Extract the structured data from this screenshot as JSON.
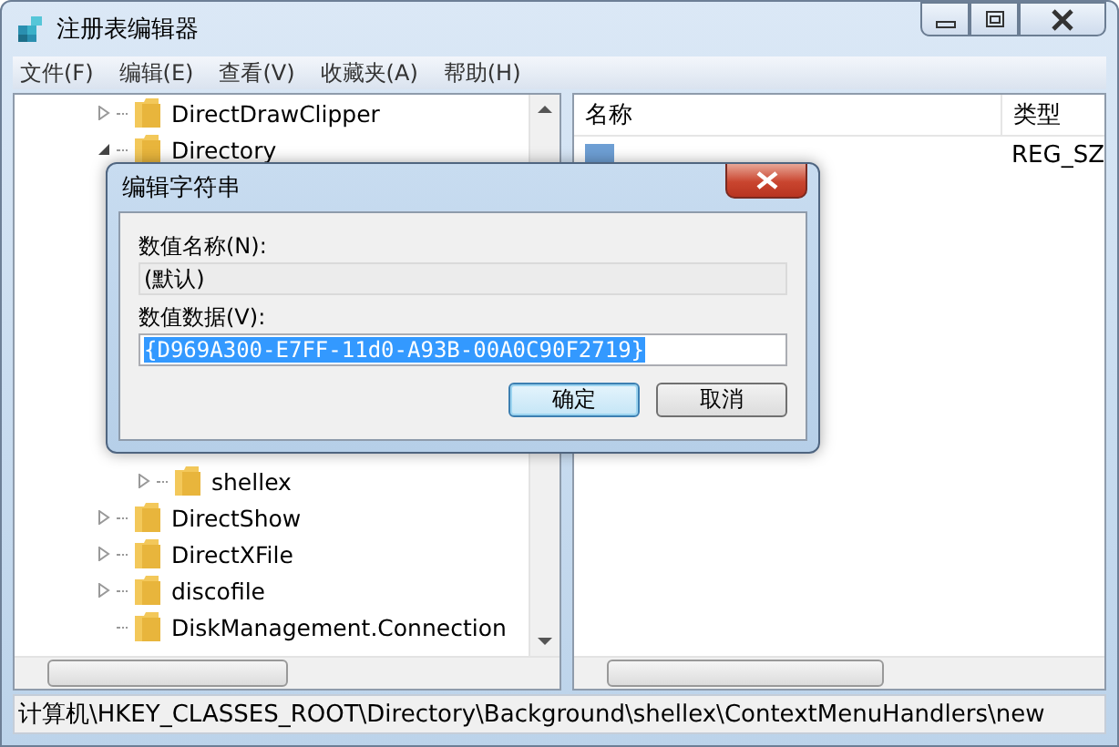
{
  "window": {
    "title": "注册表编辑器"
  },
  "menu": [
    "文件(F)",
    "编辑(E)",
    "查看(V)",
    "收藏夹(A)",
    "帮助(H)"
  ],
  "tree": {
    "items": [
      {
        "label": "DirectDrawClipper",
        "expandable": true,
        "expanded": false
      },
      {
        "label": "Directory",
        "expandable": true,
        "expanded": true,
        "children": [
          {
            "label": "shellex",
            "expandable": true,
            "expanded": false
          }
        ]
      },
      {
        "label": "DirectShow",
        "expandable": true,
        "expanded": false
      },
      {
        "label": "DirectXFile",
        "expandable": true,
        "expanded": false
      },
      {
        "label": "discofile",
        "expandable": true,
        "expanded": false
      },
      {
        "label": "DiskManagement.Connection",
        "expandable": false,
        "expanded": false
      }
    ]
  },
  "list": {
    "columns": [
      "名称",
      "类型"
    ],
    "rows": [
      {
        "type": "REG_SZ"
      }
    ]
  },
  "dialog": {
    "title": "编辑字符串",
    "fields": [
      {
        "label": "数值名称(N):",
        "value": "(默认)",
        "disabled": true,
        "selected": false
      },
      {
        "label": "数值数据(V):",
        "value": "{D969A300-E7FF-11d0-A93B-00A0C90F2719}",
        "disabled": false,
        "selected": true
      }
    ],
    "buttons": [
      {
        "label": "确定",
        "default": true
      },
      {
        "label": "取消",
        "default": false
      }
    ]
  },
  "status_bar": "计算机\\HKEY_CLASSES_ROOT\\Directory\\Background\\shellex\\ContextMenuHandlers\\new"
}
